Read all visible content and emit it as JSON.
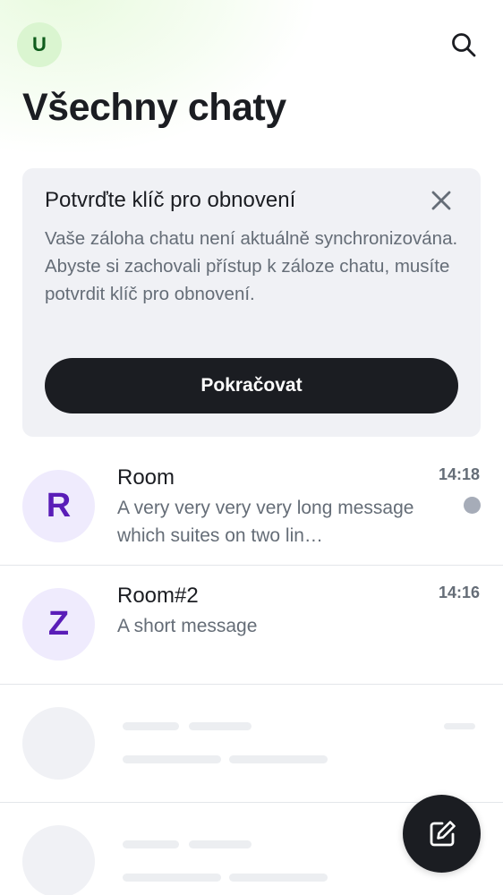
{
  "header": {
    "user_avatar_letter": "U",
    "title": "Všechny chaty"
  },
  "banner": {
    "title": "Potvrďte klíč pro obnovení",
    "body": "Vaše záloha chatu není aktuálně synchronizována. Abyste si zachovali přístup k záloze chatu, musíte potvrdit klíč pro obnovení.",
    "button_label": "Pokračovat"
  },
  "rooms": [
    {
      "avatar_letter": "R",
      "name": "Room",
      "message": "A very very very very long message which suites on two lin…",
      "time": "14:18",
      "unread": true
    },
    {
      "avatar_letter": "Z",
      "name": "Room#2",
      "message": "A short message",
      "time": "14:16",
      "unread": false
    }
  ],
  "colors": {
    "user_avatar_bg": "#daf5d0",
    "user_avatar_fg": "#0f5d1c",
    "room_avatar_bg": "#efebfd",
    "room_avatar_fg": "#5a1db8",
    "primary_button": "#1b1d22",
    "unread_dot": "#a6acb8"
  },
  "icons": {
    "search": "search-icon",
    "close": "close-icon",
    "compose": "compose-icon"
  }
}
